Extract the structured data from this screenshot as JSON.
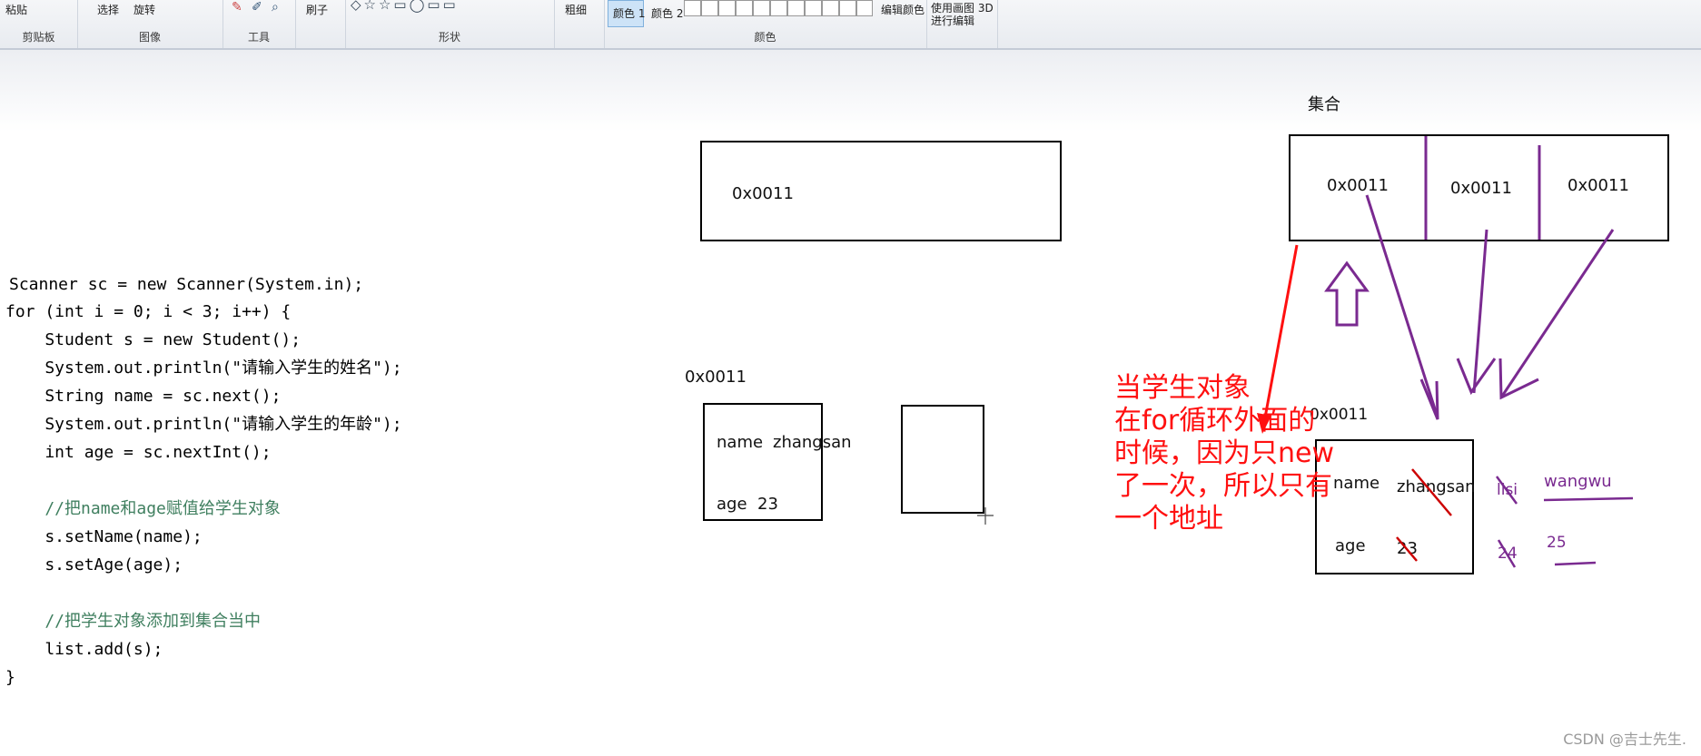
{
  "ribbon": {
    "groups": [
      {
        "label": "剪贴板",
        "item": "粘贴"
      },
      {
        "label": "图像",
        "item": "选择",
        "item2": "旋转"
      },
      {
        "label": "工具",
        "item": ""
      },
      {
        "label": "",
        "item": "刷子"
      },
      {
        "label": "形状",
        "item": ""
      },
      {
        "label": "",
        "item": "粗细"
      },
      {
        "label": "颜色",
        "item": "颜色 1",
        "item2": "颜色 2",
        "item3": "编辑颜色"
      },
      {
        "label": "",
        "item": "使用画图 3D 进行编辑"
      }
    ]
  },
  "code": {
    "lines": [
      "Scanner sc = new Scanner(System.in);",
      "for (int i = 0; i < 3; i++) {",
      "    Student s = new Student();",
      "    System.out.println(\"请输入学生的姓名\");",
      "    String name = sc.next();",
      "    System.out.println(\"请输入学生的年龄\");",
      "    int age = sc.nextInt();",
      "",
      "    //把name和age赋值给学生对象",
      "    s.setName(name);",
      "    s.setAge(age);",
      "",
      "    //把学生对象添加到集合当中",
      "    list.add(s);",
      "}"
    ]
  },
  "diagram": {
    "variable_box_address": "0x0011",
    "object_address_left": "0x0011",
    "object_left": {
      "name_label": "name",
      "name_value": "zhangsan",
      "age_label": "age",
      "age_value": "23"
    },
    "collection_title": "集合",
    "collection_cells": [
      "0x0011",
      "0x0011",
      "0x0011"
    ],
    "object_address_right": "0x0011",
    "object_right": {
      "name_label": "name",
      "name_value": "zhangsan",
      "age_label": "age",
      "age_value": "23"
    },
    "overwrites": {
      "name2": "lisi",
      "name3": "wangwu",
      "age2": "24",
      "age3": "25"
    },
    "annotation_lines": [
      "当学生对象",
      "在for循环外面的",
      "时候，因为只new",
      "了一次，所以只有",
      "一个地址"
    ],
    "colors": {
      "annotation": "#ff1010",
      "pen": "#7a2a90",
      "strike": "#cc0000"
    }
  },
  "watermark": "CSDN @吉士先生."
}
